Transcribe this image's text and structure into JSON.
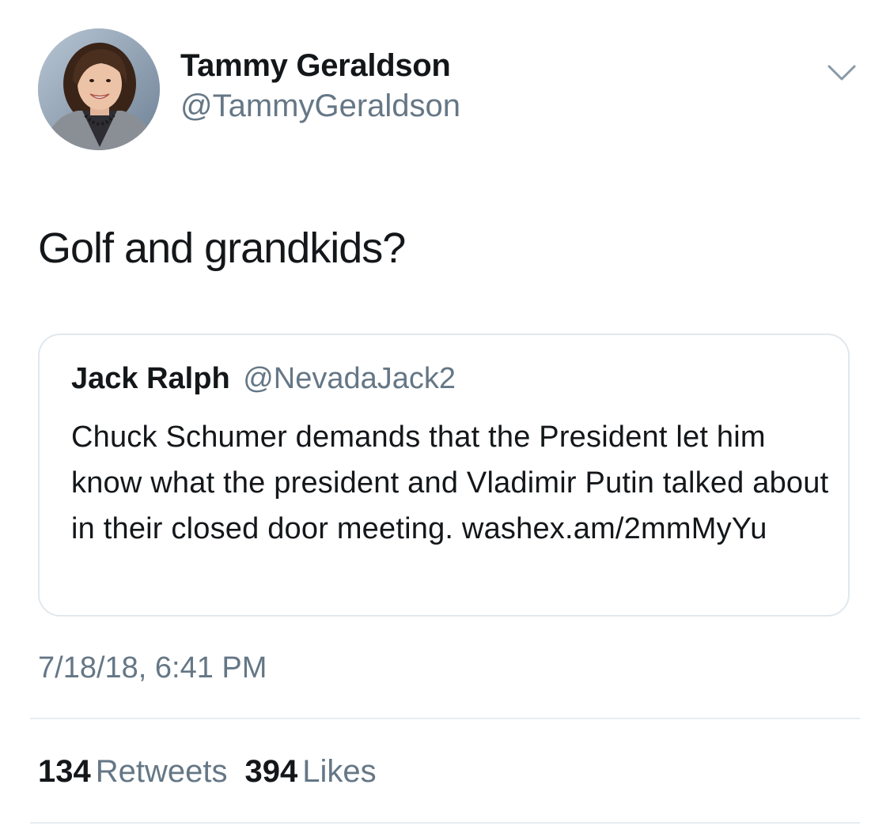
{
  "author": {
    "name": "Tammy Geraldson",
    "handle": "@TammyGeraldson"
  },
  "tweet": {
    "text": "Golf and grandkids?"
  },
  "quoted": {
    "name": "Jack Ralph",
    "handle": "@NevadaJack2",
    "text": "Chuck Schumer demands that the President let him know what the president and Vladimir Putin talked about in their closed door meeting. washex.am/2mmMyYu"
  },
  "timestamp": "7/18/18, 6:41 PM",
  "stats": {
    "retweets_count": "134",
    "retweets_label": "Retweets",
    "likes_count": "394",
    "likes_label": "Likes"
  },
  "icons": {
    "menu": "chevron-down-icon"
  },
  "colors": {
    "primary_text": "#14171a",
    "secondary_text": "#657786",
    "border": "#e1e8ed"
  }
}
